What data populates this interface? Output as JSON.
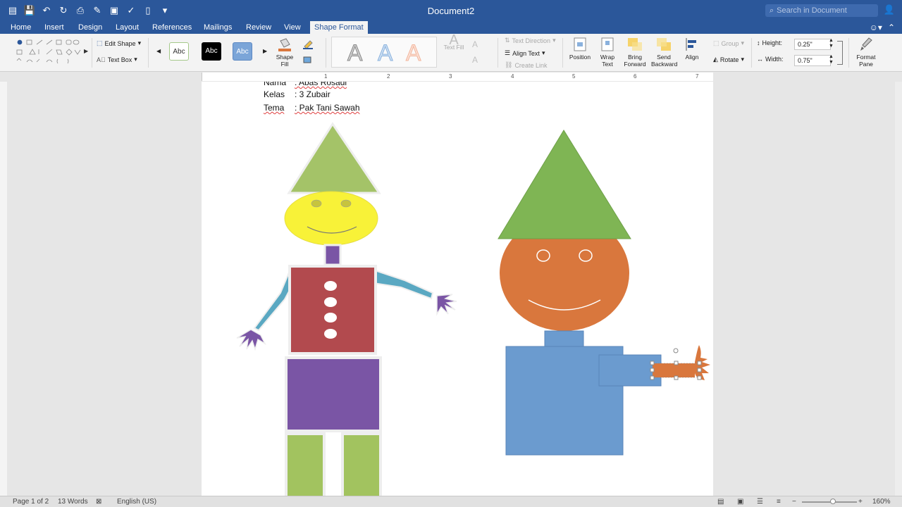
{
  "app": {
    "title": "Document2",
    "search_placeholder": "Search in Document"
  },
  "tabs": [
    {
      "label": "Home"
    },
    {
      "label": "Insert"
    },
    {
      "label": "Design"
    },
    {
      "label": "Layout"
    },
    {
      "label": "References"
    },
    {
      "label": "Mailings"
    },
    {
      "label": "Review"
    },
    {
      "label": "View"
    },
    {
      "label": "Shape Format",
      "active": true
    }
  ],
  "ribbon": {
    "edit_shape": "Edit Shape",
    "text_box": "Text Box",
    "style_label": "Abc",
    "shape_fill": "Shape\nFill",
    "text_fill": "Text Fill",
    "text_direction": "Text Direction",
    "align_text": "Align Text",
    "create_link": "Create Link",
    "position": "Position",
    "wrap_text": "Wrap\nText",
    "bring_forward": "Bring\nForward",
    "send_backward": "Send\nBackward",
    "align": "Align",
    "group": "Group",
    "rotate": "Rotate",
    "height_label": "Height:",
    "height_value": "0.25\"",
    "width_label": "Width:",
    "width_value": "0.75\"",
    "format_pane": "Format\nPane"
  },
  "ruler": {
    "numbers": [
      "1",
      "2",
      "3",
      "4",
      "5",
      "6",
      "7"
    ]
  },
  "document": {
    "lines": [
      {
        "key": "Nama",
        "value": ": Abas Rosadi"
      },
      {
        "key": "Kelas",
        "value": ": 3 Zubair"
      },
      {
        "key": "Tema",
        "value": ": Pak Tani Sawah"
      }
    ]
  },
  "status": {
    "page": "Page 1 of 2",
    "words": "13 Words",
    "language": "English (US)",
    "zoom": "160%"
  },
  "colors": {
    "brand": "#2b579a",
    "hat_green_light": "#a4c368",
    "hat_green": "#7fb554",
    "face_yellow": "#f8f238",
    "face_orange": "#d9773d",
    "shirt_red": "#b24a4e",
    "pants_purple": "#7a55a5",
    "arm_teal": "#5aa8c2",
    "legs_green": "#a2c35f",
    "body_blue": "#6b9bcf"
  }
}
